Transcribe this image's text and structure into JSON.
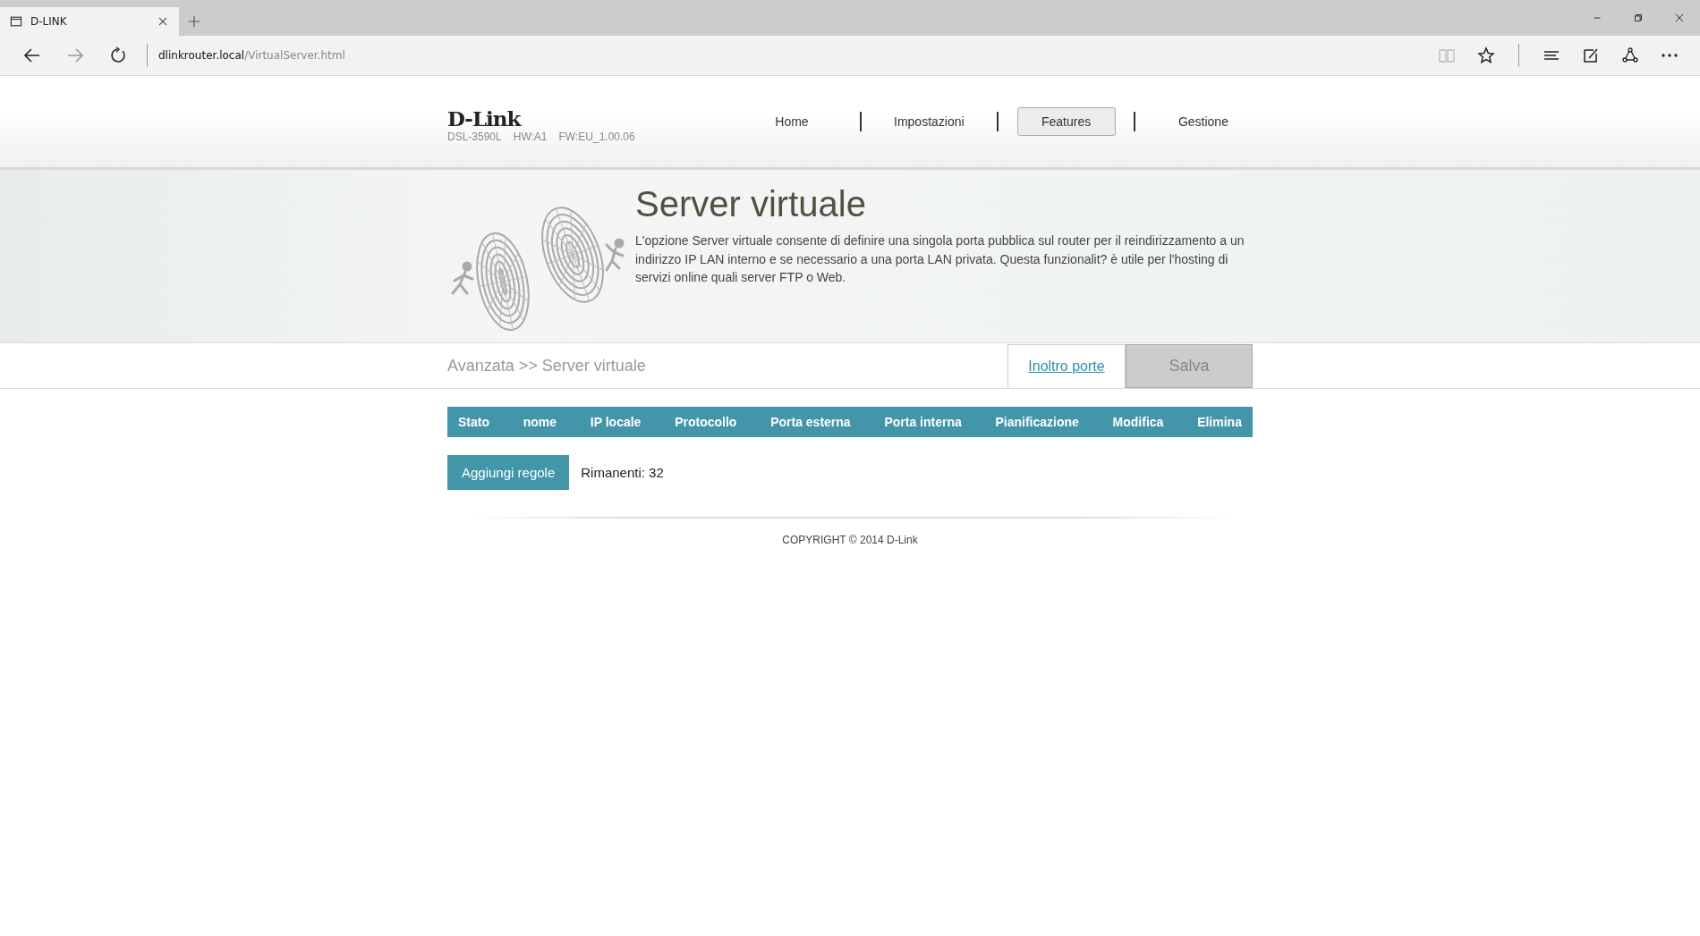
{
  "browser": {
    "tab_title": "D-LINK",
    "url_host": "dlinkrouter.local",
    "url_path": "/VirtualServer.html"
  },
  "header": {
    "logo": "D-Link",
    "model": "DSL-3590L",
    "hw": "HW:A1",
    "fw": "FW:EU_1.00.06",
    "nav": [
      {
        "label": "Home",
        "selected": false
      },
      {
        "label": "Impostazioni",
        "selected": false
      },
      {
        "label": "Features",
        "selected": true
      },
      {
        "label": "Gestione",
        "selected": false
      }
    ]
  },
  "hero": {
    "title": "Server virtuale",
    "description": "L'opzione Server virtuale consente di definire una singola porta pubblica sul router per il reindirizzamento a un indirizzo IP LAN interno e se necessario a una porta LAN privata. Questa funzionalit? è utile per l'hosting di servizi online quali server FTP o Web."
  },
  "breadcrumb": "Avanzata >> Server virtuale",
  "actions": {
    "link": "Inoltro porte",
    "save": "Salva"
  },
  "table": {
    "columns": [
      "Stato",
      "nome",
      "IP locale",
      "Protocollo",
      "Porta esterna",
      "Porta interna",
      "Pianificazione",
      "Modifica",
      "Elimina"
    ]
  },
  "add_button": "Aggiungi regole",
  "remaining": "Rimanenti: 32",
  "footer": "COPYRIGHT © 2014 D-Link"
}
